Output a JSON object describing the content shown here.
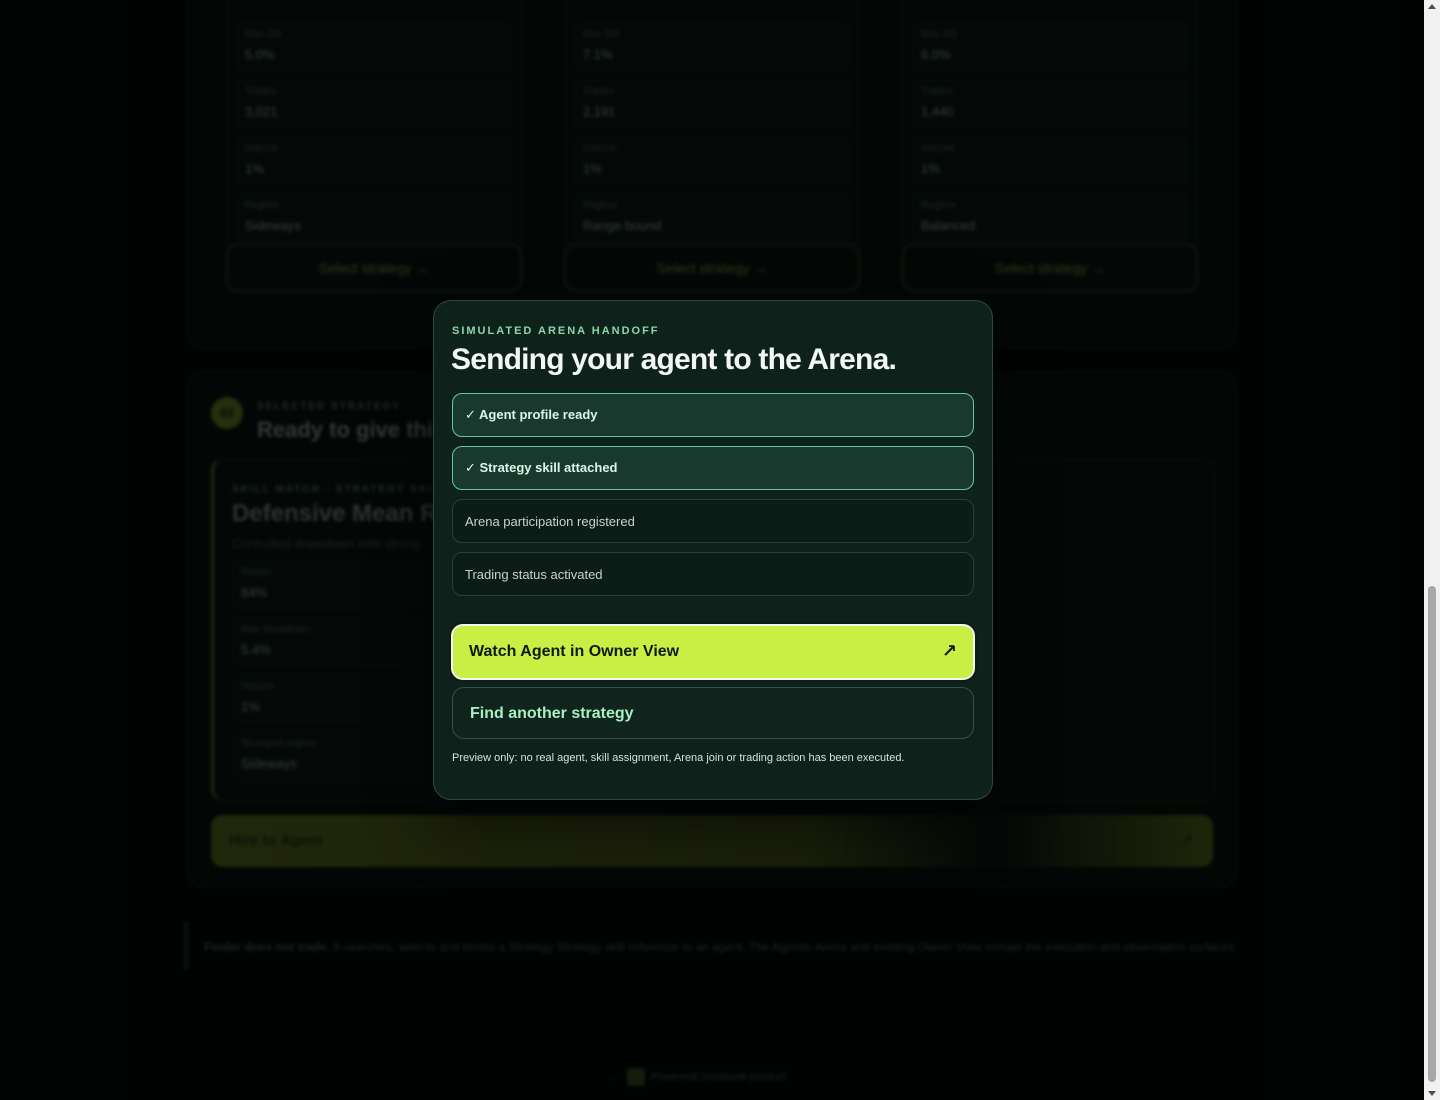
{
  "background": {
    "cards": [
      {
        "stats": [
          {
            "label": "Max DD",
            "value": "5.0%"
          },
          {
            "label": "Trades",
            "value": "3,021"
          },
          {
            "label": "Volume",
            "value": "1%"
          },
          {
            "label": "Regime",
            "value": "Sideways"
          }
        ],
        "select_label": "Select strategy →"
      },
      {
        "stats": [
          {
            "label": "Max DD",
            "value": "7.1%"
          },
          {
            "label": "Trades",
            "value": "2,191"
          },
          {
            "label": "Volume",
            "value": "1%"
          },
          {
            "label": "Regime",
            "value": "Range bound"
          }
        ],
        "select_label": "Select strategy →"
      },
      {
        "stats": [
          {
            "label": "Max DD",
            "value": "6.0%"
          },
          {
            "label": "Trades",
            "value": "1,440"
          },
          {
            "label": "Volume",
            "value": "1%"
          },
          {
            "label": "Regime",
            "value": "Balanced"
          }
        ],
        "select_label": "Select strategy →"
      }
    ],
    "selected": {
      "step_number": "03",
      "label": "SELECTED STRATEGY",
      "heading": "Ready to give this",
      "meta": "SKILL MATCH · STRATEGY SKILL",
      "name": "Defensive Mean Re",
      "desc": "Controlled drawdown with strong",
      "stats": [
        {
          "label": "Return",
          "value": "84%"
        },
        {
          "label": "Max Drawdown",
          "value": "5.4%"
        },
        {
          "label": "Volume",
          "value": "1%"
        },
        {
          "label": "Strongest regime",
          "value": "Sideways"
        }
      ]
    },
    "hire_label": "Hire to Agent",
    "note_bold": "Finder does not trade.",
    "note_rest": "It searches, selects and bonds a Strategy Strategy skill reference to an agent. The Agentic Arena and existing Owner View remain the execution and observation surfaces.",
    "footer": "PoweredCrossbook product"
  },
  "modal": {
    "eyebrow": "SIMULATED ARENA HANDOFF",
    "title": "Sending your agent to the Arena.",
    "steps": [
      {
        "label": "✓ Agent profile ready",
        "done": true
      },
      {
        "label": "✓ Strategy skill attached",
        "done": true
      },
      {
        "label": "Arena participation registered",
        "done": false
      },
      {
        "label": "Trading status activated",
        "done": false
      }
    ],
    "primary_button": "Watch Agent in Owner View",
    "primary_icon": "arrow-up-right-icon",
    "secondary_button": "Find another strategy",
    "preview_note": "Preview only: no real agent, skill assignment, Arena join or trading action has been executed.",
    "accent_color": "#c8f044"
  }
}
